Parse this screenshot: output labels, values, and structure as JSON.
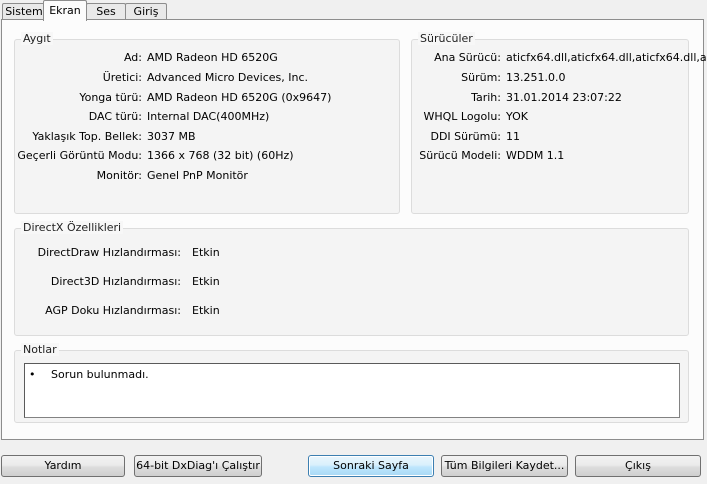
{
  "tabs": [
    {
      "label": "Sistem",
      "active": false
    },
    {
      "label": "Ekran",
      "active": true
    },
    {
      "label": "Ses",
      "active": false
    },
    {
      "label": "Giriş",
      "active": false
    }
  ],
  "device": {
    "legend": "Aygıt",
    "rows": [
      {
        "label": "Ad:",
        "value": "AMD Radeon HD 6520G"
      },
      {
        "label": "Üretici:",
        "value": "Advanced Micro Devices, Inc."
      },
      {
        "label": "Yonga türü:",
        "value": "AMD Radeon HD 6520G (0x9647)"
      },
      {
        "label": "DAC türü:",
        "value": "Internal DAC(400MHz)"
      },
      {
        "label": "Yaklaşık Top. Bellek:",
        "value": "3037 MB"
      },
      {
        "label": "Geçerli Görüntü Modu:",
        "value": "1366 x 768 (32 bit) (60Hz)"
      },
      {
        "label": "Monitör:",
        "value": "Genel PnP Monitör"
      }
    ]
  },
  "drivers": {
    "legend": "Sürücüler",
    "rows": [
      {
        "label": "Ana Sürücü:",
        "value": "aticfx64.dll,aticfx64.dll,aticfx64.dll,a"
      },
      {
        "label": "Sürüm:",
        "value": "13.251.0.0"
      },
      {
        "label": "Tarih:",
        "value": "31.01.2014 23:07:22"
      },
      {
        "label": "WHQL Logolu:",
        "value": "YOK"
      },
      {
        "label": "DDI Sürümü:",
        "value": "11"
      },
      {
        "label": "Sürücü Modeli:",
        "value": "WDDM 1.1"
      }
    ]
  },
  "directx": {
    "legend": "DirectX Özellikleri",
    "rows": [
      {
        "label": "DirectDraw Hızlandırması:",
        "value": "Etkin"
      },
      {
        "label": "Direct3D Hızlandırması:",
        "value": "Etkin"
      },
      {
        "label": "AGP Doku Hızlandırması:",
        "value": "Etkin"
      }
    ]
  },
  "notes": {
    "legend": "Notlar",
    "bullet": "•",
    "items": [
      "Sorun bulunmadı."
    ]
  },
  "buttons": {
    "help": "Yardım",
    "run64": "64-bit DxDiag'ı Çalıştır",
    "next": "Sonraki Sayfa",
    "save_all": "Tüm Bilgileri Kaydet...",
    "exit": "Çıkış"
  }
}
